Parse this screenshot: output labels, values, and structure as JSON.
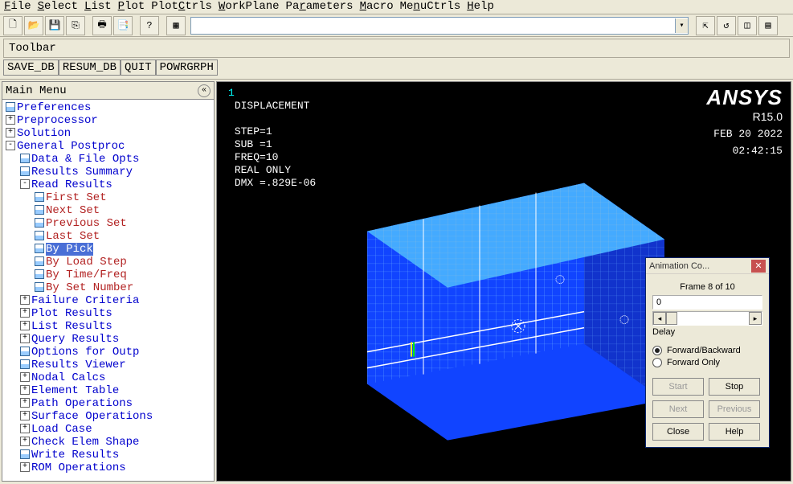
{
  "menubar": {
    "file": "File",
    "select": "Select",
    "list": "List",
    "plot": "Plot",
    "plotctrls": "PlotCtrls",
    "workplane": "WorkPlane",
    "parameters": "Parameters",
    "macro": "Macro",
    "menuctrls": "MenuCtrls",
    "help": "Help"
  },
  "toolbar_label": "Toolbar",
  "cmdbtns": {
    "save": "SAVE_DB",
    "resum": "RESUM_DB",
    "quit": "QUIT",
    "pow": "POWRGRPH"
  },
  "mainmenu_title": "Main Menu",
  "tree": [
    {
      "d": 0,
      "ico": "grid",
      "cls": "blue",
      "t": "Preferences"
    },
    {
      "d": 0,
      "ico": "+",
      "cls": "blue",
      "t": "Preprocessor"
    },
    {
      "d": 0,
      "ico": "+",
      "cls": "blue",
      "t": "Solution"
    },
    {
      "d": 0,
      "ico": "-",
      "cls": "blue",
      "t": "General Postproc"
    },
    {
      "d": 1,
      "ico": "grid",
      "cls": "blue",
      "t": "Data & File Opts"
    },
    {
      "d": 1,
      "ico": "grid",
      "cls": "blue",
      "t": "Results Summary"
    },
    {
      "d": 1,
      "ico": "-",
      "cls": "blue",
      "t": "Read Results"
    },
    {
      "d": 2,
      "ico": "grid",
      "cls": "red",
      "t": "First Set"
    },
    {
      "d": 2,
      "ico": "grid",
      "cls": "red",
      "t": "Next Set"
    },
    {
      "d": 2,
      "ico": "grid",
      "cls": "red",
      "t": "Previous Set"
    },
    {
      "d": 2,
      "ico": "grid",
      "cls": "red",
      "t": "Last Set"
    },
    {
      "d": 2,
      "ico": "grid",
      "cls": "red",
      "t": "By Pick",
      "sel": true
    },
    {
      "d": 2,
      "ico": "grid",
      "cls": "red",
      "t": "By Load Step"
    },
    {
      "d": 2,
      "ico": "grid",
      "cls": "red",
      "t": "By Time/Freq"
    },
    {
      "d": 2,
      "ico": "grid",
      "cls": "red",
      "t": "By Set Number"
    },
    {
      "d": 1,
      "ico": "+",
      "cls": "blue",
      "t": "Failure Criteria"
    },
    {
      "d": 1,
      "ico": "+",
      "cls": "blue",
      "t": "Plot Results"
    },
    {
      "d": 1,
      "ico": "+",
      "cls": "blue",
      "t": "List Results"
    },
    {
      "d": 1,
      "ico": "+",
      "cls": "blue",
      "t": "Query Results"
    },
    {
      "d": 1,
      "ico": "grid",
      "cls": "blue",
      "t": "Options for Outp"
    },
    {
      "d": 1,
      "ico": "grid",
      "cls": "blue",
      "t": "Results Viewer"
    },
    {
      "d": 1,
      "ico": "+",
      "cls": "blue",
      "t": "Nodal Calcs"
    },
    {
      "d": 1,
      "ico": "+",
      "cls": "blue",
      "t": "Element Table"
    },
    {
      "d": 1,
      "ico": "+",
      "cls": "blue",
      "t": "Path Operations"
    },
    {
      "d": 1,
      "ico": "+",
      "cls": "blue",
      "t": "Surface Operations"
    },
    {
      "d": 1,
      "ico": "+",
      "cls": "blue",
      "t": "Load Case"
    },
    {
      "d": 1,
      "ico": "+",
      "cls": "blue",
      "t": "Check Elem Shape"
    },
    {
      "d": 1,
      "ico": "grid",
      "cls": "blue",
      "t": "Write Results"
    },
    {
      "d": 1,
      "ico": "+",
      "cls": "blue",
      "t": "ROM Operations"
    }
  ],
  "viewport": {
    "idx": "1",
    "title": "DISPLACEMENT",
    "step": "STEP=1",
    "sub": "SUB =1",
    "freq": "FREQ=10",
    "real": "REAL ONLY",
    "dmx": "DMX =.829E-06",
    "brand": "ANSYS",
    "release": "R15.0",
    "date": "FEB 20 2022",
    "time": "02:42:15"
  },
  "dialog": {
    "title": "Animation Co...",
    "frame_lbl": "Frame  8 of 10",
    "delay_val": "0",
    "delay_lbl": "Delay",
    "opt1": "Forward/Backward",
    "opt2": "Forward Only",
    "start": "Start",
    "stop": "Stop",
    "next": "Next",
    "prev": "Previous",
    "close": "Close",
    "help": "Help"
  }
}
